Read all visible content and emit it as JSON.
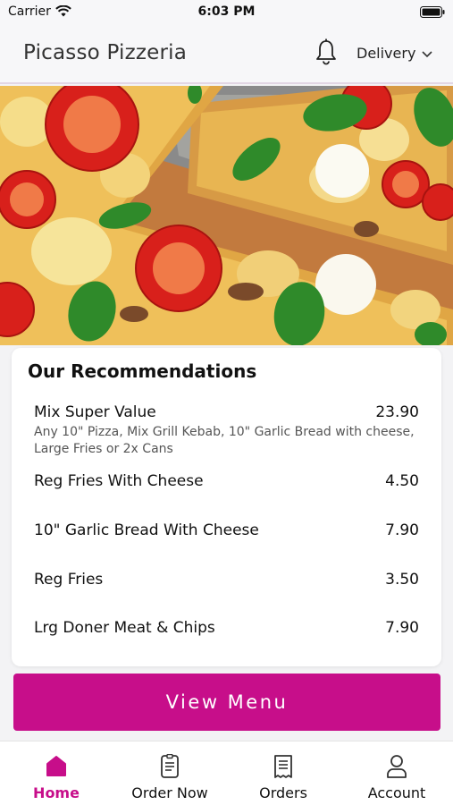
{
  "status_bar": {
    "carrier": "Carrier",
    "time": "6:03 PM"
  },
  "header": {
    "title": "Picasso Pizzeria",
    "delivery_label": "Delivery"
  },
  "recommendations": {
    "heading": "Our Recommendations",
    "items": [
      {
        "name": "Mix Super Value",
        "price": "23.90",
        "description": "Any 10\" Pizza, Mix Grill Kebab, 10\" Garlic Bread with cheese, Large Fries or 2x Cans"
      },
      {
        "name": "Reg Fries With Cheese",
        "price": "4.50"
      },
      {
        "name": "10\" Garlic Bread With Cheese",
        "price": "7.90"
      },
      {
        "name": "Reg Fries",
        "price": "3.50"
      },
      {
        "name": "Lrg Doner Meat & Chips",
        "price": "7.90"
      }
    ]
  },
  "view_menu_label": "View Menu",
  "tabs": [
    {
      "label": "Home",
      "icon": "home-icon",
      "active": true
    },
    {
      "label": "Order Now",
      "icon": "order-icon",
      "active": false
    },
    {
      "label": "Orders",
      "icon": "receipt-icon",
      "active": false
    },
    {
      "label": "Account",
      "icon": "person-icon",
      "active": false
    }
  ],
  "colors": {
    "accent": "#c70e8a",
    "header_bg": "#f7f7f9"
  }
}
